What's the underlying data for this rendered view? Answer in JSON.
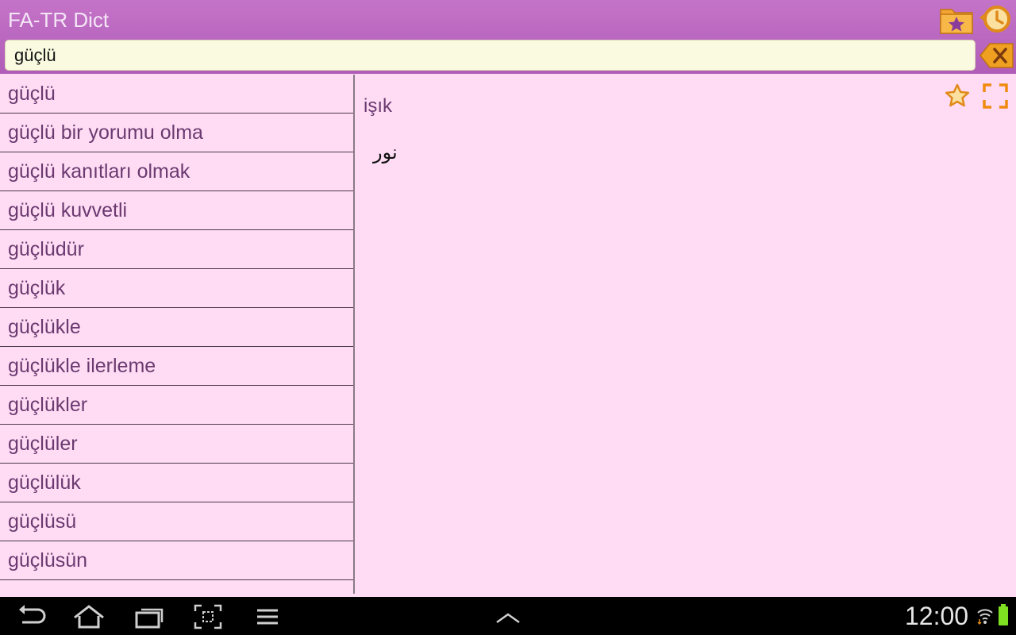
{
  "app": {
    "title": "FA-TR Dict"
  },
  "search": {
    "value": "güçlü"
  },
  "word_list": [
    "güçlü",
    "güçlü bir yorumu olma",
    "güçlü kanıtları olmak",
    "güçlü kuvvetli",
    "güçlüdür",
    "güçlük",
    "güçlükle",
    "güçlükle ilerleme",
    "güçlükler",
    "güçlüler",
    "güçlülük",
    "güçlüsü",
    "güçlüsün"
  ],
  "detail": {
    "word": "işık",
    "translation": "نور"
  },
  "status": {
    "time": "12:00"
  },
  "colors": {
    "header": "#b866c0",
    "background": "#ffdcf4",
    "accent": "#f0a020",
    "list_text": "#6a3a70"
  },
  "icons": {
    "favorites_folder": "folder-star-icon",
    "history": "history-clock-icon",
    "clear": "backspace-clear-icon",
    "detail_star": "star-outline-icon",
    "fullscreen": "fullscreen-icon",
    "nav": [
      "back-icon",
      "home-icon",
      "recent-apps-icon",
      "screenshot-icon",
      "menu-icon",
      "chevron-up-icon"
    ],
    "status": [
      "wifi-icon",
      "battery-icon"
    ]
  }
}
